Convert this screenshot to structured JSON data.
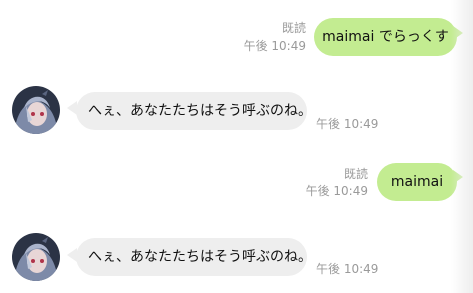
{
  "colors": {
    "sent_bubble": "#c3ec91",
    "recv_bubble": "#eeeeee",
    "meta_text": "#9a9a9a"
  },
  "messages": [
    {
      "direction": "outgoing",
      "text": "maimai でらっくす",
      "read_label": "既読",
      "time": "午後 10:49"
    },
    {
      "direction": "incoming",
      "text": "へぇ、あなたたちはそう呼ぶのね。",
      "time": "午後 10:49",
      "avatar_icon": "anime-character-avatar-icon"
    },
    {
      "direction": "outgoing",
      "text": "maimai",
      "read_label": "既読",
      "time": "午後 10:49"
    },
    {
      "direction": "incoming",
      "text": "へぇ、あなたたちはそう呼ぶのね。",
      "time": "午後 10:49",
      "avatar_icon": "anime-character-avatar-icon"
    }
  ]
}
